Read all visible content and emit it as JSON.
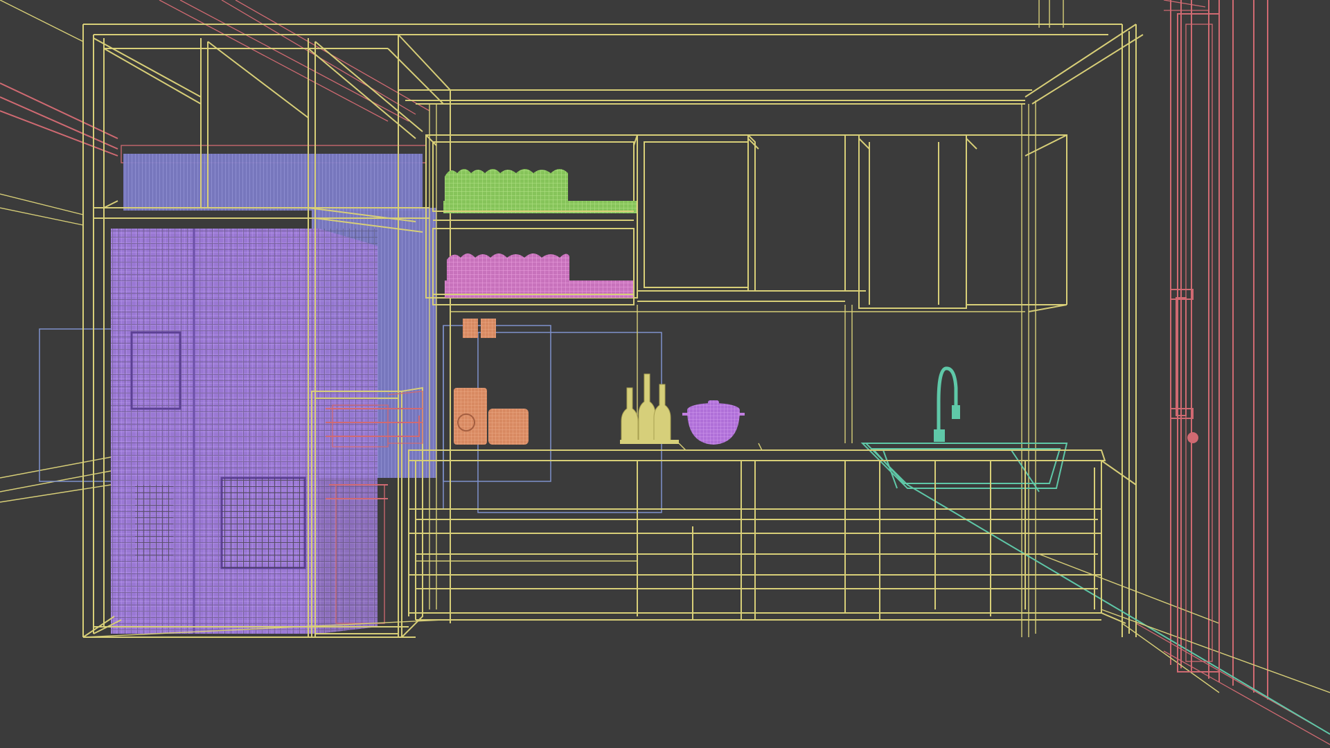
{
  "viewport": {
    "view_mode": "wireframe",
    "background_color": "#3b3b3b"
  },
  "colors": {
    "cabinetry": "#d8cf78",
    "walls": "#d06a72",
    "refrigerator": "#a884dc",
    "curtain": "#8c8cd8",
    "dish_rack_upper_plates": "#9ad46a",
    "dish_rack_lower_plates": "#d884cc",
    "appliances": "#e4966e",
    "pot": "#c07ee0",
    "faucet_and_sink": "#5fc8a8",
    "window_frames": "#7f92cc"
  },
  "objects": [
    "refrigerator",
    "curtain",
    "tall-shelf-unit",
    "dish-rack-upper",
    "dish-rack-lower",
    "wall-cabinets",
    "wall-outlet",
    "coffee-maker",
    "toaster",
    "bottles",
    "pot",
    "faucet",
    "sink",
    "base-cabinets",
    "countertop",
    "door",
    "door-handle",
    "window-frames"
  ]
}
